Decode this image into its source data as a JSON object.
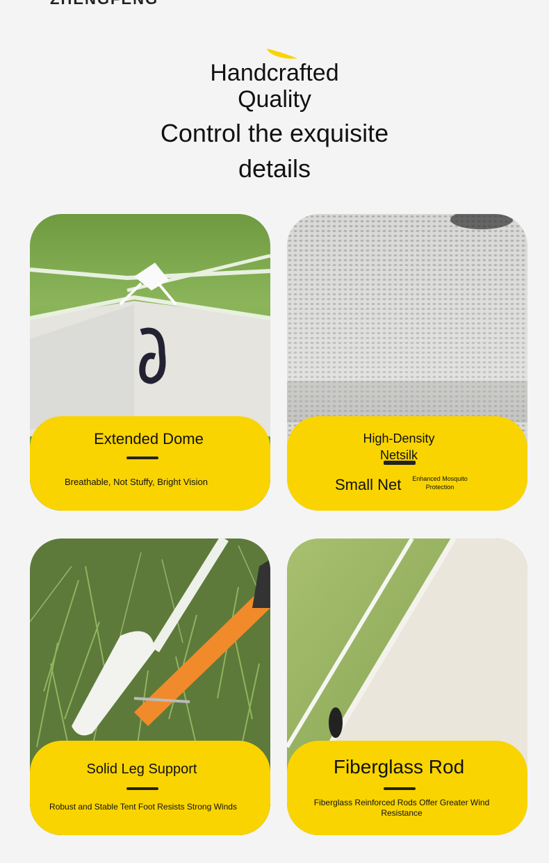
{
  "brand": "ZHENGFENG",
  "heading": {
    "line1": "Handcrafted Quality",
    "line2": "Control the exquisite details"
  },
  "colors": {
    "accent": "#f9d400",
    "background": "#f4f4f4",
    "text": "#111111"
  },
  "cards": [
    {
      "image": "tent-dome-roof-with-hook-photo",
      "title": "Extended Dome",
      "subtitle": "Breathable, Not Stuffy, Bright Vision"
    },
    {
      "image": "mesh-net-closeup-photo",
      "title_top": "High-Density Netsilk",
      "title": "Small Net",
      "note": "Enhanced Mosquito Protection"
    },
    {
      "image": "tent-peg-in-grass-photo",
      "title": "Solid Leg Support",
      "subtitle": "Robust and Stable Tent Foot Resists Strong Winds"
    },
    {
      "image": "fiberglass-rod-tent-corner-photo",
      "title": "Fiberglass Rod",
      "subtitle": "Fiberglass Reinforced Rods Offer Greater Wind Resistance"
    }
  ]
}
